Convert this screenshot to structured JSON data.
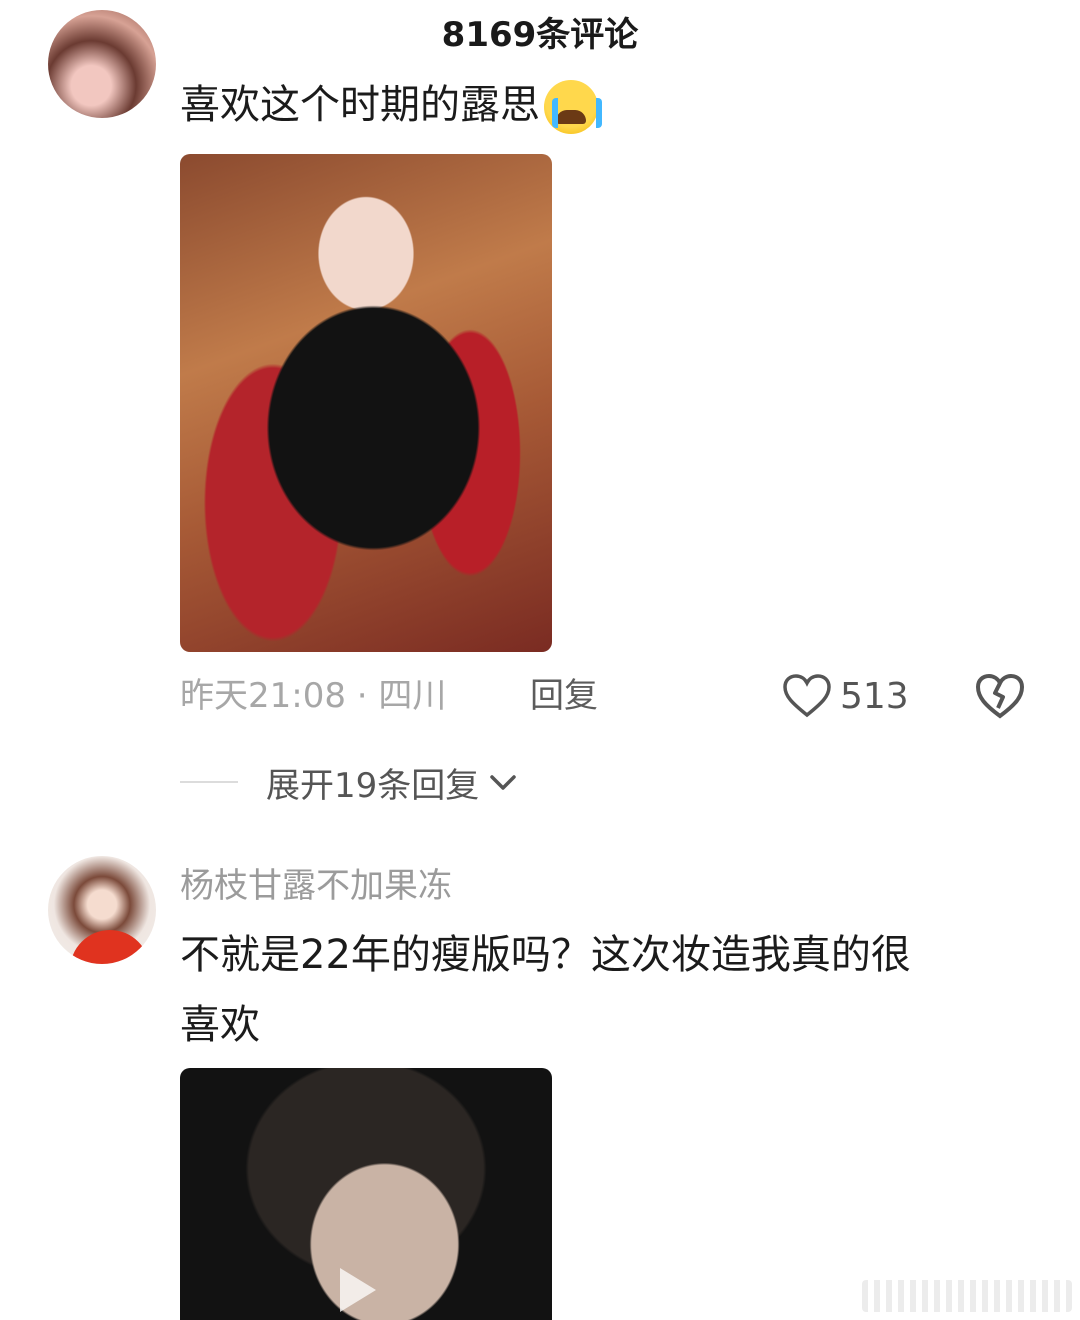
{
  "header": {
    "title": "8169条评论"
  },
  "comments": [
    {
      "text": "喜欢这个时期的露思",
      "emoji": "loudly-crying-face",
      "meta": "昨天21:08 · 四川",
      "reply_label": "回复",
      "likes": "513",
      "expand_label": "展开19条回复"
    },
    {
      "username": "杨枝甘露不加果冻",
      "text_line1": "不就是22年的瘦版吗？这次妆造我真的很",
      "text_line2": "喜欢"
    }
  ],
  "icons": {
    "like": "heart-outline-icon",
    "dislike": "broken-heart-icon",
    "expand": "chevron-down-icon",
    "play": "play-icon"
  },
  "colors": {
    "text": "#1b1b1b",
    "meta": "#a7a7a7",
    "secondary": "#555555"
  }
}
